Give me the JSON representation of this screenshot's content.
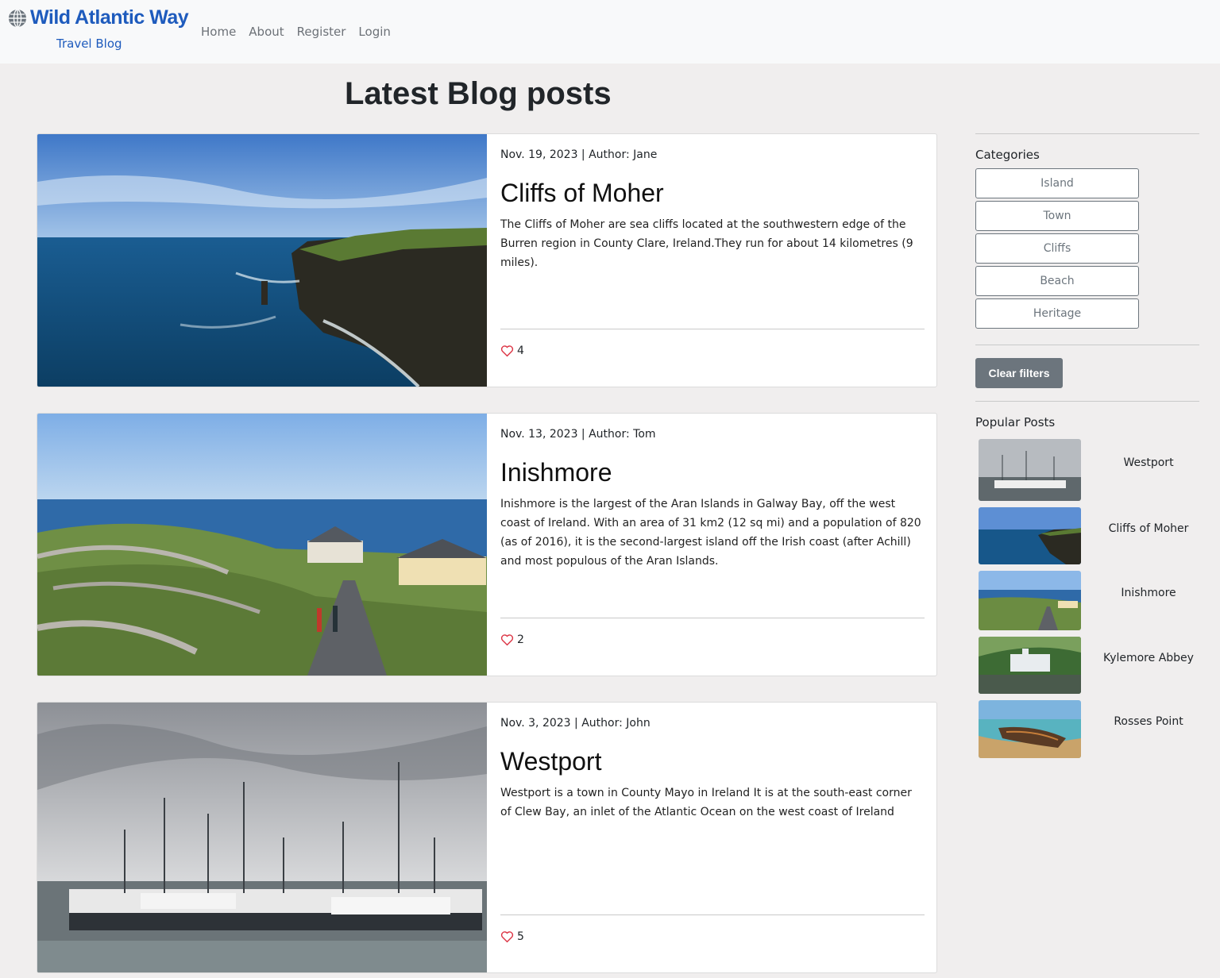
{
  "brand": {
    "title": "Wild Atlantic Way",
    "subtitle": "Travel Blog"
  },
  "nav": {
    "items": [
      "Home",
      "About",
      "Register",
      "Login"
    ]
  },
  "page": {
    "title": "Latest Blog posts"
  },
  "posts": [
    {
      "meta": "Nov. 19, 2023 | Author: Jane",
      "title": "Cliffs of Moher",
      "excerpt": "The Cliffs of Moher are sea cliffs located at the southwestern edge of the Burren region in County Clare, Ireland.They run for about 14 kilometres (9 miles).",
      "likes": "4"
    },
    {
      "meta": "Nov. 13, 2023 | Author: Tom",
      "title": "Inishmore",
      "excerpt": "Inishmore is the largest of the Aran Islands in Galway Bay, off the west coast of Ireland. With an area of 31 km2 (12 sq mi) and a population of 820 (as of 2016), it is the second-largest island off the Irish coast (after Achill) and most populous of the Aran Islands.",
      "likes": "2"
    },
    {
      "meta": "Nov. 3, 2023 | Author: John",
      "title": "Westport",
      "excerpt": "Westport is a town in County Mayo in Ireland It is at the south-east corner of Clew Bay, an inlet of the Atlantic Ocean on the west coast of Ireland",
      "likes": "5"
    }
  ],
  "sidebar": {
    "categories_heading": "Categories",
    "categories": [
      "Island",
      "Town",
      "Cliffs",
      "Beach",
      "Heritage"
    ],
    "clear_label": "Clear filters",
    "popular_heading": "Popular Posts",
    "popular": [
      "Westport",
      "Cliffs of Moher",
      "Inishmore",
      "Kylemore Abbey",
      "Rosses Point"
    ]
  },
  "colors": {
    "brand": "#1e5bbd",
    "heart": "#dc3545",
    "secondary": "#6c757d",
    "background": "#f0eeee"
  }
}
